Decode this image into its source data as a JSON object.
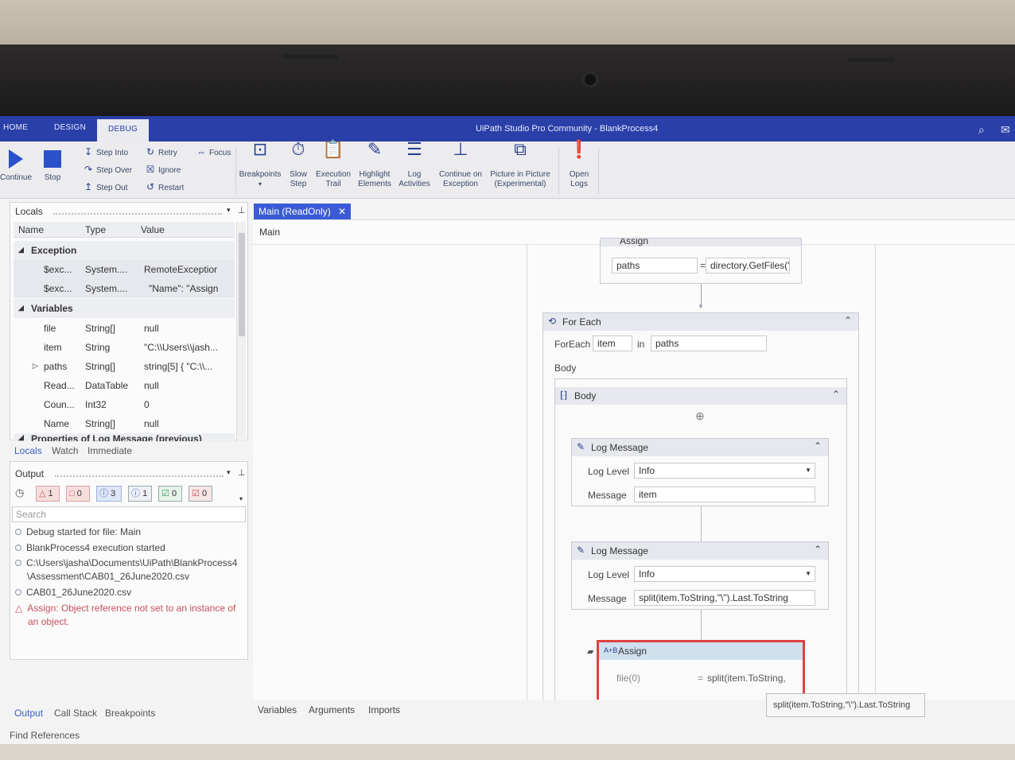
{
  "window": {
    "tabs": [
      "HOME",
      "DESIGN",
      "DEBUG"
    ],
    "active_tab": "DEBUG",
    "title": "UiPath Studio Pro Community - BlankProcess4"
  },
  "ribbon": {
    "continue": "Continue",
    "stop": "Stop",
    "step_into": "Step Into",
    "step_over": "Step Over",
    "step_out": "Step Out",
    "retry": "Retry",
    "ignore": "Ignore",
    "restart": "Restart",
    "focus": "Focus",
    "breakpoints": "Breakpoints",
    "slow_step_1": "Slow",
    "slow_step_2": "Step",
    "execution_trail_1": "Execution",
    "execution_trail_2": "Trail",
    "highlight_1": "Highlight",
    "highlight_2": "Elements",
    "log_activities_1": "Log",
    "log_activities_2": "Activities",
    "continue_exc_1": "Continue on",
    "continue_exc_2": "Exception",
    "pip_1": "Picture in Picture",
    "pip_2": "(Experimental)",
    "open_logs_1": "Open",
    "open_logs_2": "Logs"
  },
  "locals": {
    "title": "Locals",
    "columns": [
      "Name",
      "Type",
      "Value"
    ],
    "exception_group": "Exception",
    "exception_rows": [
      {
        "name": "$exc...",
        "type": "System....",
        "value": "RemoteExceptior"
      },
      {
        "name": "$exc...",
        "type": "System....",
        "value": "\"Name\": \"Assign"
      }
    ],
    "variables_group": "Variables",
    "variable_rows": [
      {
        "name": "file",
        "type": "String[]",
        "value": "null"
      },
      {
        "name": "item",
        "type": "String",
        "value": "\"C:\\\\Users\\\\jash..."
      },
      {
        "name": "paths",
        "type": "String[]",
        "value": "string[5] { \"C:\\\\..."
      },
      {
        "name": "Read...",
        "type": "DataTable",
        "value": "null"
      },
      {
        "name": "Coun...",
        "type": "Int32",
        "value": "0"
      },
      {
        "name": "Name",
        "type": "String[]",
        "value": "null"
      }
    ],
    "cut_group": "Properties of Log Message (previous)",
    "tabs": [
      "Locals",
      "Watch",
      "Immediate"
    ]
  },
  "output": {
    "title": "Output",
    "filters": [
      {
        "icon": "△",
        "count": "1",
        "color": "#c8505a"
      },
      {
        "icon": "□",
        "count": "0",
        "color": "#c8505a"
      },
      {
        "icon": "ⓘ",
        "count": "3",
        "color": "#3a5fc8"
      },
      {
        "icon": "ⓘ",
        "count": "1",
        "color": "#3a5fc8"
      },
      {
        "icon": "☑",
        "count": "0",
        "color": "#3a9a5a"
      },
      {
        "icon": "☑",
        "count": "0",
        "color": "#c8505a"
      }
    ],
    "search_placeholder": "Search",
    "lines": [
      "Debug started for file: Main",
      "BlankProcess4 execution started",
      "C:\\Users\\jasha\\Documents\\UiPath\\BlankProcess4",
      "\\Assessment\\CAB01_26June2020.csv",
      "CAB01_26June2020.csv",
      "Assign: Object reference not set to an instance of",
      "an object."
    ],
    "tabs": [
      "Output",
      "Call Stack",
      "Breakpoints"
    ],
    "find_references": "Find References"
  },
  "designer": {
    "doc_tab": "Main (ReadOnly)",
    "breadcrumb": "Main",
    "assign_top": {
      "title": "Assign",
      "to": "paths",
      "value": "directory.GetFiles(\""
    },
    "for_each": {
      "title": "For Each",
      "foreach_label": "ForEach",
      "item": "item",
      "in_label": "in",
      "collection": "paths",
      "body_label": "Body"
    },
    "body_seq": {
      "title": "Body"
    },
    "log1": {
      "title": "Log Message",
      "level_label": "Log Level",
      "level": "Info",
      "message_label": "Message",
      "message": "item"
    },
    "log2": {
      "title": "Log Message",
      "level_label": "Log Level",
      "level": "Info",
      "message_label": "Message",
      "message": "split(item.ToString,\"\\\").Last.ToString"
    },
    "assign_err": {
      "title": "Assign",
      "to": "file(0)",
      "value": "split(item.ToString,"
    },
    "tooltip": "split(item.ToString,\"\\\").Last.ToString",
    "footer_tabs": [
      "Variables",
      "Arguments",
      "Imports"
    ]
  }
}
